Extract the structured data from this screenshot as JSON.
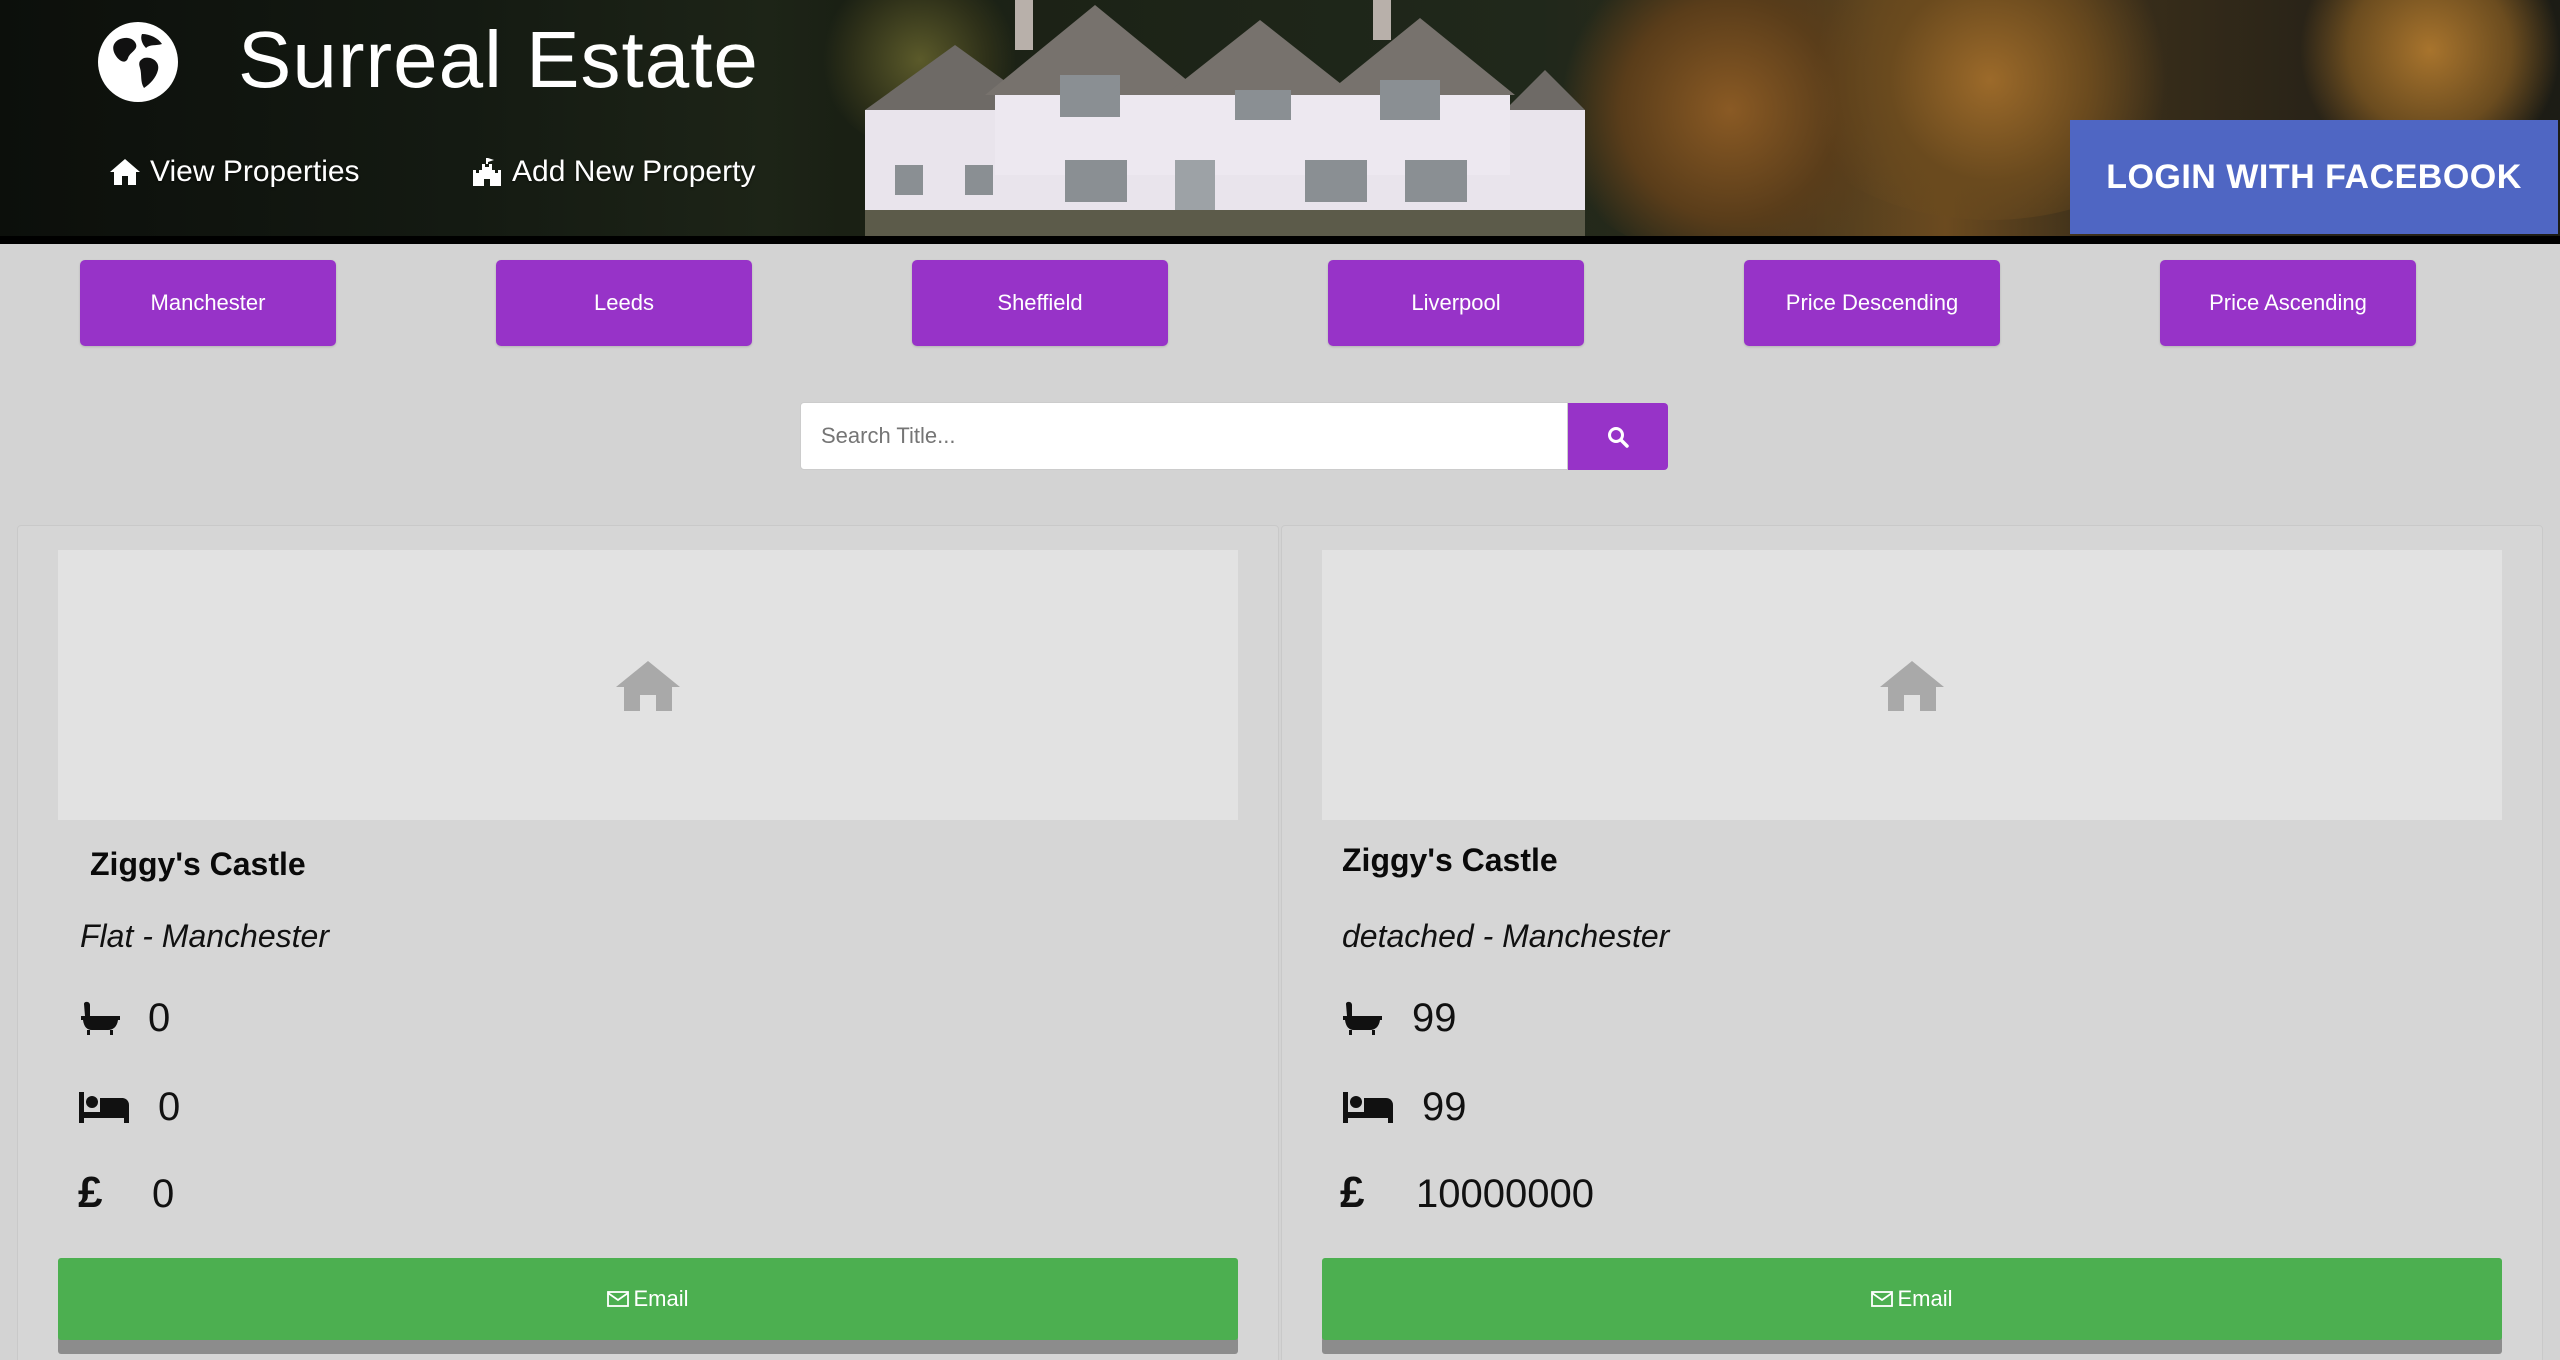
{
  "header": {
    "brand_title": "Surreal Estate",
    "nav": [
      {
        "label": "View Properties",
        "icon": "home-icon"
      },
      {
        "label": "Add New Property",
        "icon": "castle-icon"
      }
    ],
    "login_label": "LOGIN WITH FACEBOOK"
  },
  "filters": [
    "Manchester",
    "Leeds",
    "Sheffield",
    "Liverpool",
    "Price Descending",
    "Price Ascending"
  ],
  "search": {
    "placeholder": "Search Title...",
    "icon": "search-icon"
  },
  "cards": [
    {
      "title": "Ziggy's Castle",
      "subtitle": "Flat - Manchester",
      "bathrooms": "0",
      "bedrooms": "0",
      "currency_symbol": "£",
      "price": "0",
      "email_label": "Email"
    },
    {
      "title": "Ziggy's Castle",
      "subtitle": "detached - Manchester",
      "bathrooms": "99",
      "bedrooms": "99",
      "currency_symbol": "£",
      "price": "10000000",
      "email_label": "Email"
    }
  ],
  "colors": {
    "accent": "#9733c8",
    "facebook": "#4f66c3",
    "email": "#4caf50",
    "background": "#d3d3d3"
  }
}
